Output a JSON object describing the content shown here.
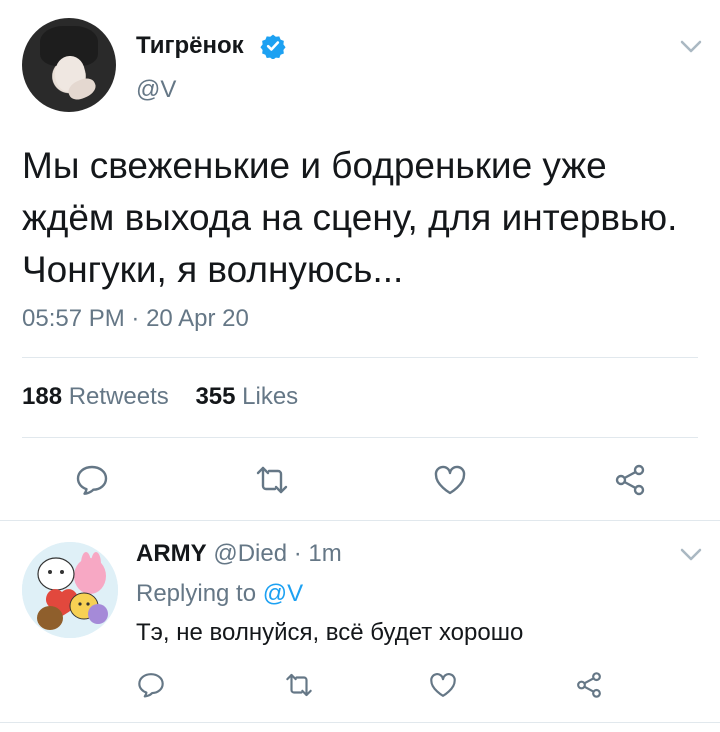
{
  "tweet": {
    "author_name": "Тигрёнок",
    "author_handle": "@V",
    "text": "Мы свеженькие и бодренькие уже ждём выхода на сцену, для интервью. Чонгуки, я волнуюсь...",
    "time": "05:57 PM",
    "separator": "·",
    "date": "20 Apr 20",
    "retweets_count": "188",
    "retweets_label": "Retweets",
    "likes_count": "355",
    "likes_label": "Likes",
    "verified_icon": "verified-badge-icon",
    "colors": {
      "verified": "#1da1f2",
      "muted": "#657786",
      "divider": "#e1e8ed"
    }
  },
  "reply": {
    "author_name": "ARMY",
    "author_handle": "@Died",
    "separator": "·",
    "time": "1m",
    "replying_prefix": "Replying to",
    "replying_to": "@V",
    "text": "Тэ, не волнуйся, всё будет хорошо"
  },
  "actions": [
    "reply-icon",
    "retweet-icon",
    "like-icon",
    "share-icon"
  ]
}
